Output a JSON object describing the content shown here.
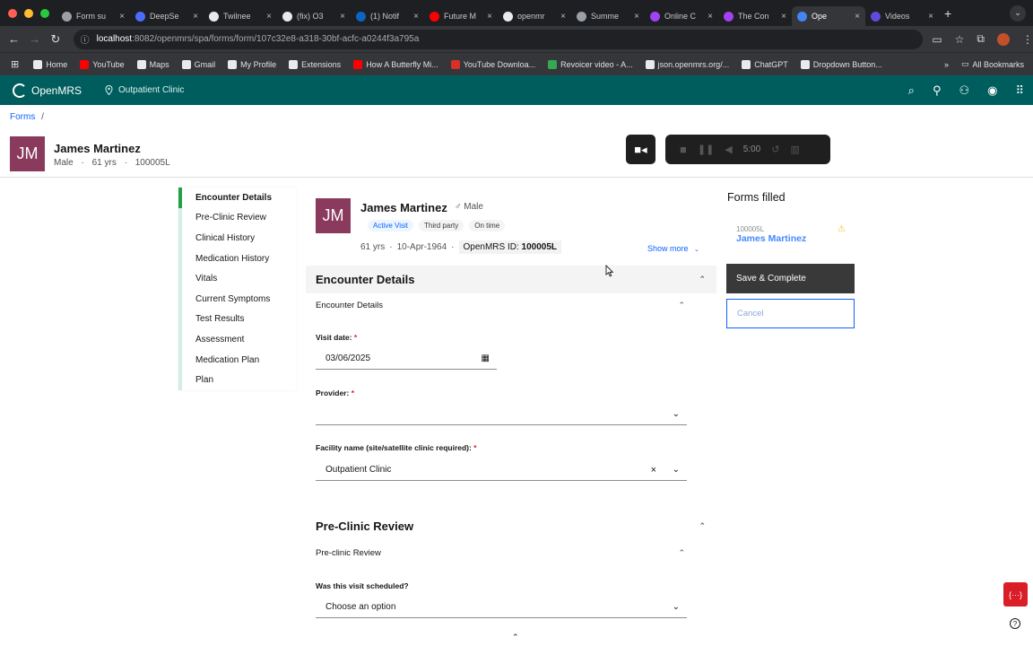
{
  "browser": {
    "tabs": [
      {
        "title": "Form su",
        "color": "#9aa0a6"
      },
      {
        "title": "DeepSe",
        "color": "#4d6bfe"
      },
      {
        "title": "Twilnee",
        "color": "#e8eaed"
      },
      {
        "title": "(fix) O3",
        "color": "#e8eaed"
      },
      {
        "title": "(1) Notif",
        "color": "#0a66c2"
      },
      {
        "title": "Future M",
        "color": "#ff0000"
      },
      {
        "title": "openmr",
        "color": "#e8eaed"
      },
      {
        "title": "Summe",
        "color": "#9aa0a6"
      },
      {
        "title": "Online C",
        "color": "#a142f4"
      },
      {
        "title": "The Con",
        "color": "#a142f4"
      },
      {
        "title": "Ope",
        "color": "#4285f4",
        "active": true
      },
      {
        "title": "Videos",
        "color": "#5f4bdb"
      }
    ],
    "url_host": "localhost",
    "url_rest": ":8082/openmrs/spa/forms/form/107c32e8-a318-30bf-acfc-a0244f3a795a",
    "bookmarks": [
      {
        "label": "Home",
        "color": "#e8eaed"
      },
      {
        "label": "YouTube",
        "color": "#ff0000"
      },
      {
        "label": "Maps",
        "color": "#e8eaed"
      },
      {
        "label": "Gmail",
        "color": "#e8eaed"
      },
      {
        "label": "My Profile",
        "color": "#e8eaed"
      },
      {
        "label": "Extensions",
        "color": "#e8eaed"
      },
      {
        "label": "How A Butterfly Mi...",
        "color": "#ff0000"
      },
      {
        "label": "YouTube Downloa...",
        "color": "#d93025"
      },
      {
        "label": "Revoicer video - A...",
        "color": "#34a853"
      },
      {
        "label": "json.openmrs.org/...",
        "color": "#e8eaed"
      },
      {
        "label": "ChatGPT",
        "color": "#e8eaed"
      },
      {
        "label": "Dropdown Button...",
        "color": "#e8eaed"
      }
    ],
    "all_bookmarks": "All Bookmarks"
  },
  "app": {
    "name": "OpenMRS",
    "location": "Outpatient Clinic"
  },
  "breadcrumb": {
    "label": "Forms",
    "sep": "/"
  },
  "patient": {
    "initials": "JM",
    "name": "James Martinez",
    "gender": "Male",
    "age": "61 yrs",
    "id": "100005L",
    "dob": "10-Apr-1964",
    "id_label": "OpenMRS ID:",
    "gender_symbol": "♂ Male",
    "tags": [
      "Active Visit",
      "Third party",
      "On time"
    ],
    "show_more": "Show more"
  },
  "recorder": {
    "time": "5:00"
  },
  "sidenav": {
    "items": [
      {
        "label": "Encounter Details",
        "active": true
      },
      {
        "label": "Pre-Clinic Review"
      },
      {
        "label": "Clinical History"
      },
      {
        "label": "Medication History"
      },
      {
        "label": "Vitals"
      },
      {
        "label": "Current Symptoms"
      },
      {
        "label": "Test Results"
      },
      {
        "label": "Assessment"
      },
      {
        "label": "Medication Plan"
      },
      {
        "label": "Plan"
      }
    ]
  },
  "form": {
    "encounter": {
      "title": "Encounter Details",
      "subtitle": "Encounter Details",
      "visit_date_label": "Visit date:",
      "visit_date_value": "03/06/2025",
      "provider_label": "Provider:",
      "provider_value": "",
      "facility_label": "Facility name (site/satellite clinic required):",
      "facility_value": "Outpatient Clinic"
    },
    "preclinic": {
      "title": "Pre-Clinic Review",
      "subtitle": "Pre-clinic Review",
      "scheduled_label": "Was this visit scheduled?",
      "scheduled_value": "Choose an option"
    }
  },
  "forms_filled": {
    "title": "Forms filled",
    "card_id": "100005L",
    "card_name": "James Martinez"
  },
  "actions": {
    "save": "Save & Complete",
    "cancel": "Cancel"
  },
  "required_mark": "*",
  "fab_label": "{···}",
  "help_label": "?"
}
